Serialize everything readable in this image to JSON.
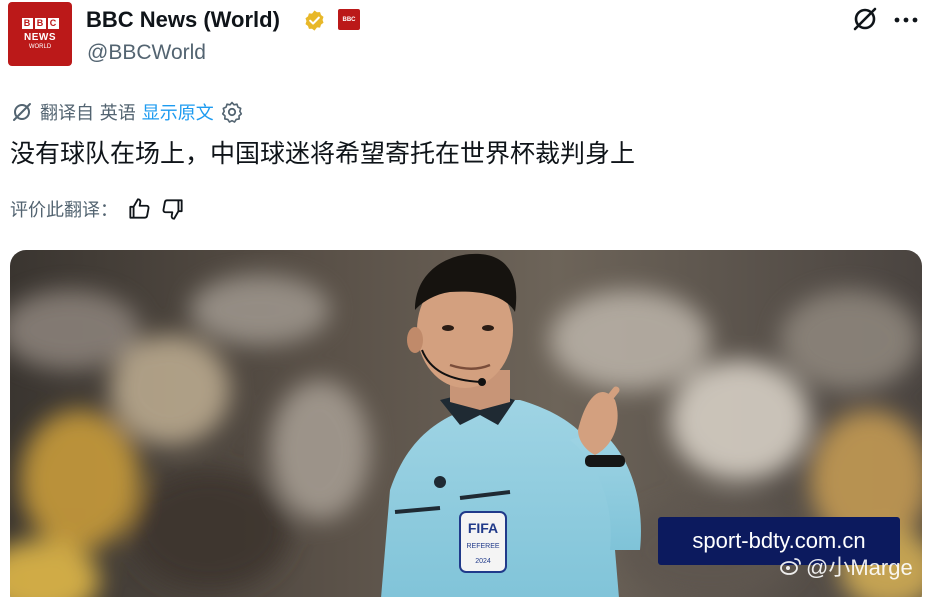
{
  "account": {
    "display_name": "BBC News (World)",
    "handle": "@BBCWorld",
    "avatar_blocks": [
      "B",
      "B",
      "C"
    ],
    "avatar_news": "NEWS",
    "avatar_world": "WORLD",
    "affiliate_badge_text": "BBC"
  },
  "translation": {
    "translated_from": "翻译自 英语",
    "show_original": "显示原文"
  },
  "tweet": {
    "text": "没有球队在场上，中国球迷将希望寄托在世界杯裁判身上"
  },
  "rating": {
    "label": "评价此翻译："
  },
  "media": {
    "jersey_badge_brand": "FIFA",
    "jersey_badge_sub": "REFEREE",
    "jersey_badge_year": "2024"
  },
  "watermarks": {
    "site": "sport-bdty.com.cn",
    "user": "@小Marge"
  },
  "colors": {
    "brand_red": "#bb1919",
    "link_blue": "#1d9bf0",
    "secondary_text": "#536471",
    "verified_gold": "#e8b829",
    "watermark_bg": "#0c1a5e"
  },
  "icons": {
    "verified": "verified-gold-badge-icon",
    "grok": "grok-icon",
    "more": "more-dots-icon",
    "translate": "translate-grok-icon",
    "settings": "gear-icon",
    "thumb_up": "thumbs-up-icon",
    "thumb_down": "thumbs-down-icon",
    "weibo": "weibo-icon"
  }
}
